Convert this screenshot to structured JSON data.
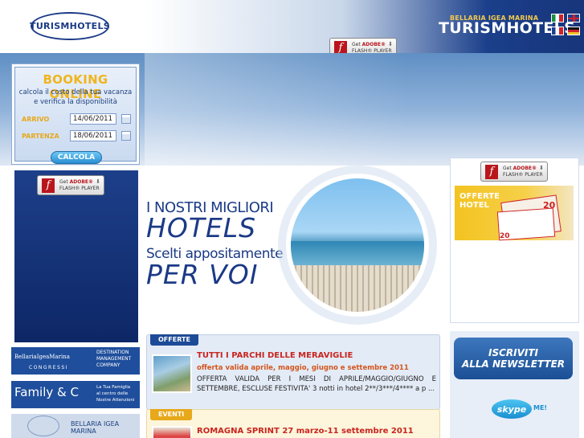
{
  "header": {
    "logo_text": "TURISMHOTELS",
    "brand_location": "BELLARIA IGEA MARINA",
    "brand_name": "TURISMHOTELS",
    "languages": [
      "it",
      "en",
      "fr",
      "de"
    ]
  },
  "flash_badge": {
    "get": "Get",
    "adobe": "ADOBE®",
    "player": "FLASH® PLAYER",
    "icon": "flash-icon"
  },
  "booking": {
    "title": "BOOKING ONLINE",
    "subtitle_line1": "calcola il costo della tua vacanza",
    "subtitle_line2": "e verifica la disponibilità",
    "arrivo_label": "ARRIVO",
    "arrivo_value": "14/06/2011",
    "partenza_label": "PARTENZA",
    "partenza_value": "18/06/2011",
    "button": "CALCOLA"
  },
  "hero": {
    "line1": "I NOSTRI MIGLIORI",
    "line2": "HOTELS",
    "line3": "Scelti appositamente",
    "line4": "PER VOI"
  },
  "right": {
    "offerte_hotel_line1": "OFFERTE",
    "offerte_hotel_line2": "HOTEL",
    "offer_num1": "20",
    "offer_num2": "20",
    "newsletter_line1": "ISCRIVITI",
    "newsletter_line2": "ALLA NEWSLETTER",
    "skype": "skype",
    "skype_me": "ME!"
  },
  "banners": {
    "congressi_name": "BellariaIgeaMarina",
    "congressi_sub": "CONGRESSI",
    "congressi_right": [
      "DESTINATION",
      "MANAGEMENT",
      "COMPANY"
    ],
    "family_name": "Family & C",
    "family_right": [
      "La Tua Famiglia",
      "al centro delle",
      "Nostre Attenzioni"
    ],
    "bim_label": "BELLARIA IGEA MARINA"
  },
  "news": [
    {
      "tag": "OFFERTE",
      "title": "TUTTI I PARCHI DELLE MERAVIGLIE",
      "subtitle": "offerta valida aprile, maggio, giugno e settembre 2011",
      "body": "OFFERTA VALIDA PER I MESI DI APRILE/MAGGIO/GIUGNO E SETTEMBRE, ESCLUSE FESTIVITA' 3 notti in hotel 2**/3***/4**** a p ..."
    },
    {
      "tag": "EVENTI",
      "title": "ROMAGNA SPRINT 27 marzo-11 settembre 2011"
    }
  ],
  "colors": {
    "brand_blue": "#1b3a86",
    "accent_yellow": "#f0b51e",
    "news_red": "#c8251e"
  }
}
